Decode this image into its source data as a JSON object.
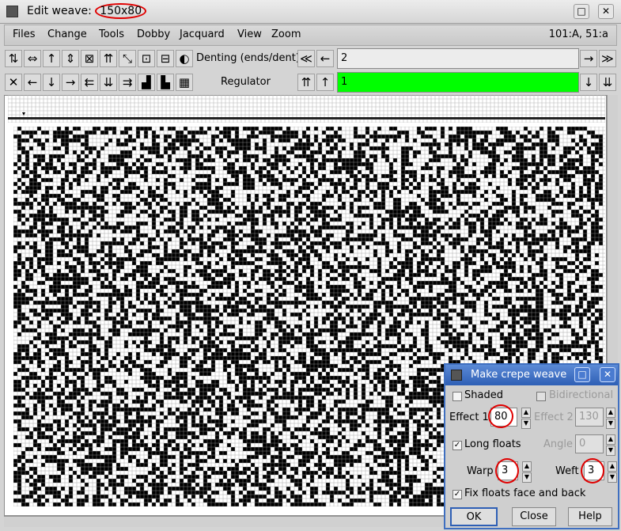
{
  "window": {
    "title_prefix": "Edit weave: ",
    "dimensions": "150x80",
    "btn_maximize": "□",
    "btn_close": "✕"
  },
  "menu": {
    "items": [
      "Files",
      "Change",
      "Tools",
      "Dobby",
      "Jacquard",
      "View",
      "Zoom"
    ],
    "coords": "101:A,  51:a"
  },
  "toolbar": {
    "row1_icons": [
      "⇅",
      "⇔",
      "↑",
      "⇕",
      "⊠",
      "⇈",
      "⤡",
      "⊡",
      "⊟",
      "◐"
    ],
    "row2_icons": [
      "✕",
      "←",
      "↓",
      "→",
      "⇇",
      "⇊",
      "⇉",
      "▟",
      "▙",
      "▦"
    ],
    "denting_label": "Denting (ends/dent)",
    "denting_value": "2",
    "regulator_label": "Regulator",
    "regulator_value": "1",
    "nav_left_double": "≪",
    "nav_left": "←",
    "nav_right": "→",
    "nav_right_double": "≫",
    "nav_up_double": "⇈",
    "nav_up": "↑",
    "nav_down": "↓",
    "nav_down_double": "⇊"
  },
  "colors": {
    "regulator_bg": "#00ff00",
    "circle": "#e00000",
    "dialog_title": "#2e5fb5"
  },
  "dialog": {
    "title": "Make crepe weave",
    "shaded_label": "Shaded",
    "bidirectional_label": "Bidirectional",
    "effect1_label": "Effect 1",
    "effect1_value": "80",
    "effect2_label": "Effect 2",
    "effect2_value": "130",
    "long_floats_label": "Long floats",
    "angle_label": "Angle",
    "angle_value": "0",
    "warp_label": "Warp",
    "warp_value": "3",
    "weft_label": "Weft",
    "weft_value": "3",
    "fix_floats_label": "Fix floats face and back",
    "ok_label": "OK",
    "close_label": "Close",
    "help_label": "Help"
  }
}
